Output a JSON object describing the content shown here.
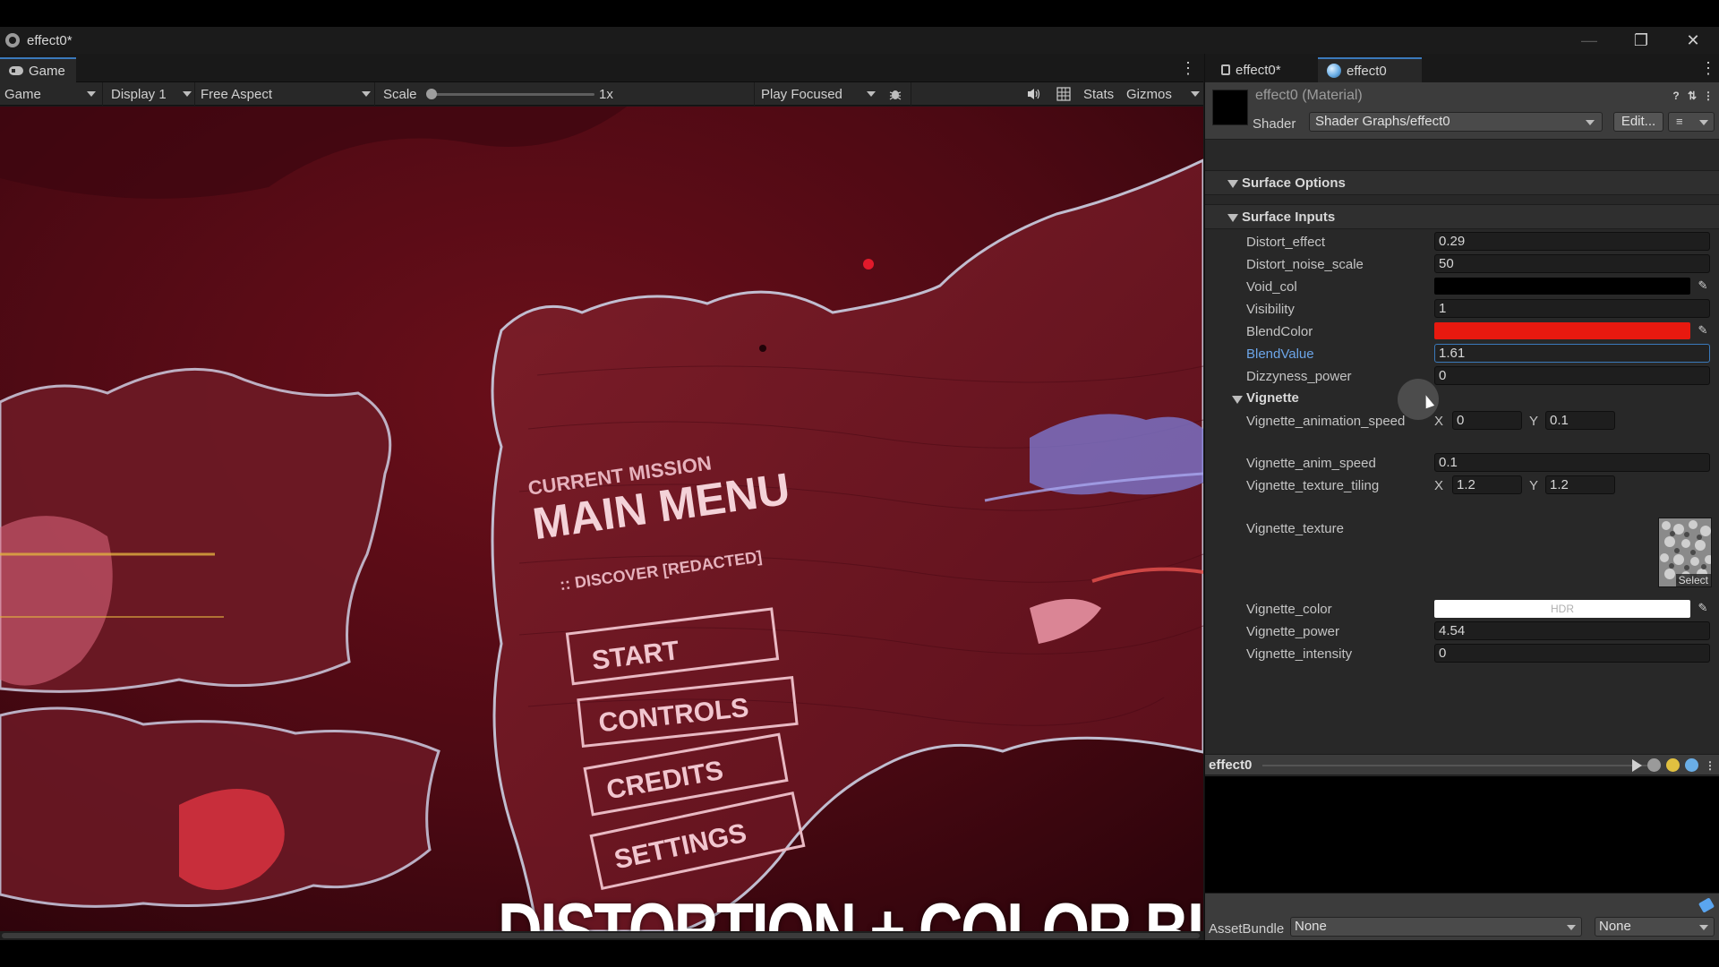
{
  "window": {
    "title": "effect0*"
  },
  "game_panel": {
    "tab_label": "Game",
    "toolbar": {
      "view_mode": "Game",
      "display": "Display 1",
      "aspect": "Free Aspect",
      "scale_label": "Scale",
      "scale_value": "1x",
      "scale_fraction": 0,
      "play_mode": "Play Focused",
      "stats": "Stats",
      "gizmos": "Gizmos"
    },
    "caption": "DISTORTION + COLOR BLENDING",
    "scene_text": {
      "menu_small": "CURRENT MISSION",
      "menu_title": "MAIN MENU",
      "menu_sub": ":: DISCOVER [REDACTED]",
      "buttons": [
        "START",
        "CONTROLS",
        "CREDITS",
        "SETTINGS"
      ]
    }
  },
  "inspector": {
    "tabs": [
      {
        "label": "effect0*",
        "icon": "lock-icon"
      },
      {
        "label": "effect0",
        "icon": "material-sphere-icon"
      }
    ],
    "material_name": "effect0 (Material)",
    "shader_label": "Shader",
    "shader_value": "Shader Graphs/effect0",
    "edit_label": "Edit...",
    "sections": {
      "surface_options": "Surface Options",
      "surface_inputs": "Surface Inputs",
      "vignette": "Vignette"
    },
    "properties": {
      "distort_effect": {
        "label": "Distort_effect",
        "value": "0.29"
      },
      "distort_noise_scale": {
        "label": "Distort_noise_scale",
        "value": "50"
      },
      "void_col": {
        "label": "Void_col",
        "color": "#000000"
      },
      "visibility": {
        "label": "Visibility",
        "value": "1"
      },
      "blend_color": {
        "label": "BlendColor",
        "color": "#e8190f"
      },
      "blend_value": {
        "label": "BlendValue",
        "value": "1.61"
      },
      "dizzyness_power": {
        "label": "Dizzyness_power",
        "value": "0"
      },
      "vignette_animation_speed": {
        "label": "Vignette_animation_speed",
        "x_label": "X",
        "x": "0",
        "y_label": "Y",
        "y": "0.1"
      },
      "vignette_anim_speed": {
        "label": "Vignette_anim_speed",
        "value": "0.1"
      },
      "vignette_texture_tiling": {
        "label": "Vignette_texture_tiling",
        "x_label": "X",
        "x": "1.2",
        "y_label": "Y",
        "y": "1.2"
      },
      "vignette_texture": {
        "label": "Vignette_texture",
        "select_label": "Select"
      },
      "vignette_color": {
        "label": "Vignette_color",
        "badge": "HDR",
        "color": "#ffffff"
      },
      "vignette_power": {
        "label": "Vignette_power",
        "value": "4.54"
      },
      "vignette_intensity": {
        "label": "Vignette_intensity",
        "value": "0"
      }
    },
    "preview_name": "effect0",
    "assetbundle_label": "AssetBundle",
    "assetbundle_value": "None",
    "assetbundle_variant": "None"
  },
  "colors": {
    "accent": "#3a79bb",
    "highlight_label": "#6ca5e8",
    "scene_base": "#4a0812"
  }
}
